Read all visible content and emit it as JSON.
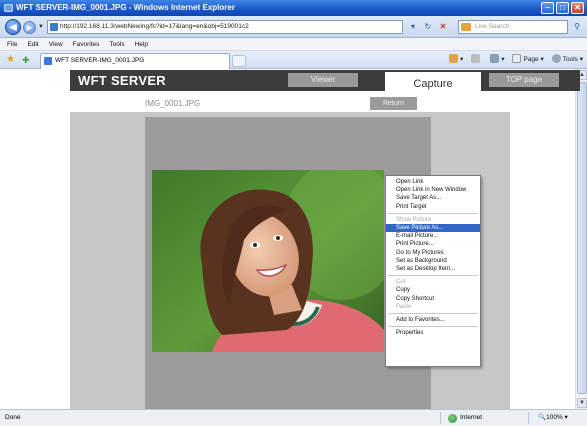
{
  "window": {
    "title": "WFT SERVER-IMG_0001.JPG - Windows Internet Explorer",
    "controls": {
      "minimize": "–",
      "maximize": "□",
      "close": "✕"
    }
  },
  "address": {
    "url": "http://192.168.11.3/webNewing/fc?id=17&lang=en&obj=519001c2",
    "search_placeholder": "Live Search"
  },
  "menu": [
    "File",
    "Edit",
    "View",
    "Favorites",
    "Tools",
    "Help"
  ],
  "tab": {
    "label": "WFT SERVER-IMG_0001.JPG"
  },
  "toolbar": {
    "home": "",
    "feeds": "",
    "print": "",
    "page": "Page",
    "tools": "Tools"
  },
  "page": {
    "brand": "WFT SERVER",
    "tabs": {
      "viewer": "Viewer",
      "capture": "Capture",
      "top": "TOP page"
    },
    "filename": "IMG_0001.JPG",
    "return_label": "Return"
  },
  "context_menu": {
    "groups": [
      [
        {
          "label": "Open Link",
          "state": "normal"
        },
        {
          "label": "Open Link in New Window",
          "state": "normal"
        },
        {
          "label": "Save Target As...",
          "state": "normal"
        },
        {
          "label": "Print Target",
          "state": "normal"
        }
      ],
      [
        {
          "label": "Show Picture",
          "state": "disabled"
        },
        {
          "label": "Save Picture As...",
          "state": "selected"
        },
        {
          "label": "E-mail Picture...",
          "state": "normal"
        },
        {
          "label": "Print Picture...",
          "state": "normal"
        },
        {
          "label": "Go to My Pictures",
          "state": "normal"
        },
        {
          "label": "Set as Background",
          "state": "normal"
        },
        {
          "label": "Set as Desktop Item...",
          "state": "normal"
        }
      ],
      [
        {
          "label": "Cut",
          "state": "disabled"
        },
        {
          "label": "Copy",
          "state": "normal"
        },
        {
          "label": "Copy Shortcut",
          "state": "normal"
        },
        {
          "label": "Paste",
          "state": "disabled"
        }
      ],
      [
        {
          "label": "Add to Favorites...",
          "state": "normal"
        }
      ],
      [
        {
          "label": "Properties",
          "state": "normal"
        }
      ]
    ]
  },
  "status": {
    "left": "Done",
    "zone": "Internet",
    "zoom": "100%"
  }
}
